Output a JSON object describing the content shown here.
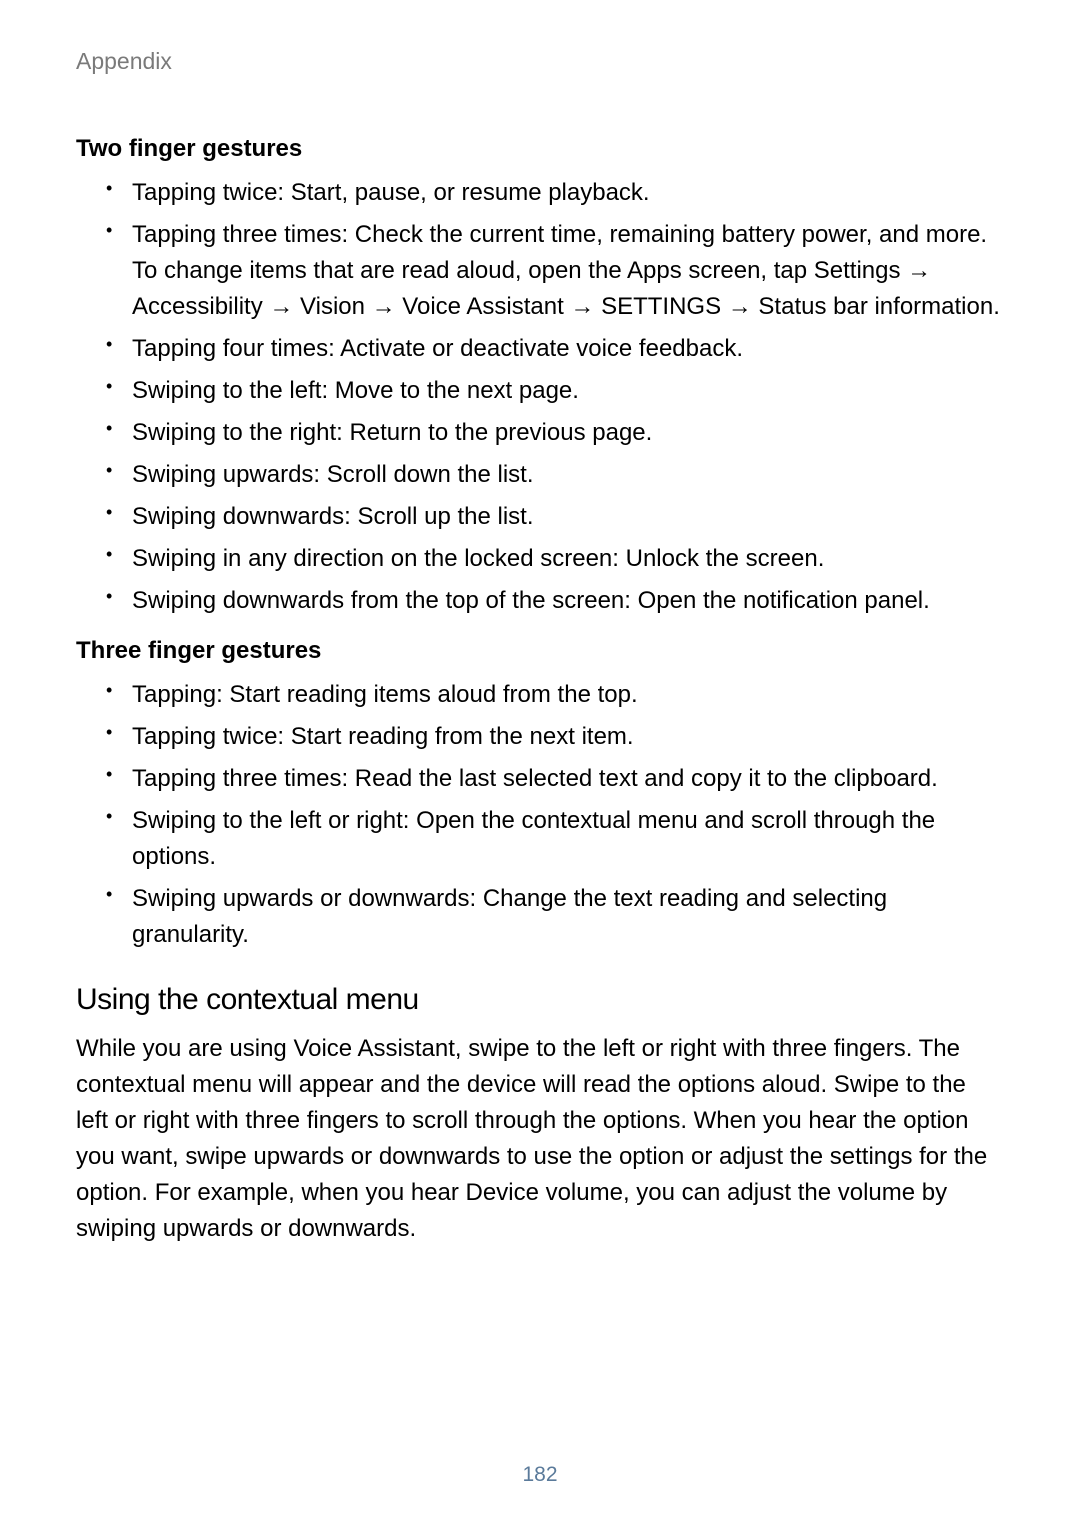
{
  "header": "Appendix",
  "section1": {
    "title": "Two finger gestures",
    "items": [
      "Tapping twice: Start, pause, or resume playback.",
      "Tapping three times: Check the current time, remaining battery power, and more. To change items that are read aloud, open the Apps screen, tap Settings → Accessibility → Vision → Voice Assistant → SETTINGS → Status bar information.",
      "Tapping four times: Activate or deactivate voice feedback.",
      "Swiping to the left: Move to the next page.",
      "Swiping to the right: Return to the previous page.",
      "Swiping upwards: Scroll down the list.",
      "Swiping downwards: Scroll up the list.",
      "Swiping in any direction on the locked screen: Unlock the screen.",
      "Swiping downwards from the top of the screen: Open the notification panel."
    ]
  },
  "section2": {
    "title": "Three finger gestures",
    "items": [
      "Tapping: Start reading items aloud from the top.",
      "Tapping twice: Start reading from the next item.",
      "Tapping three times: Read the last selected text and copy it to the clipboard.",
      "Swiping to the left or right: Open the contextual menu and scroll through the options.",
      "Swiping upwards or downwards: Change the text reading and selecting granularity."
    ]
  },
  "subheading": "Using the contextual menu",
  "paragraph": "While you are using Voice Assistant, swipe to the left or right with three fingers. The contextual menu will appear and the device will read the options aloud. Swipe to the left or right with three fingers to scroll through the options. When you hear the option you want, swipe upwards or downwards to use the option or adjust the settings for the option. For example, when you hear Device volume, you can adjust the volume by swiping upwards or downwards.",
  "pageNumber": "182"
}
